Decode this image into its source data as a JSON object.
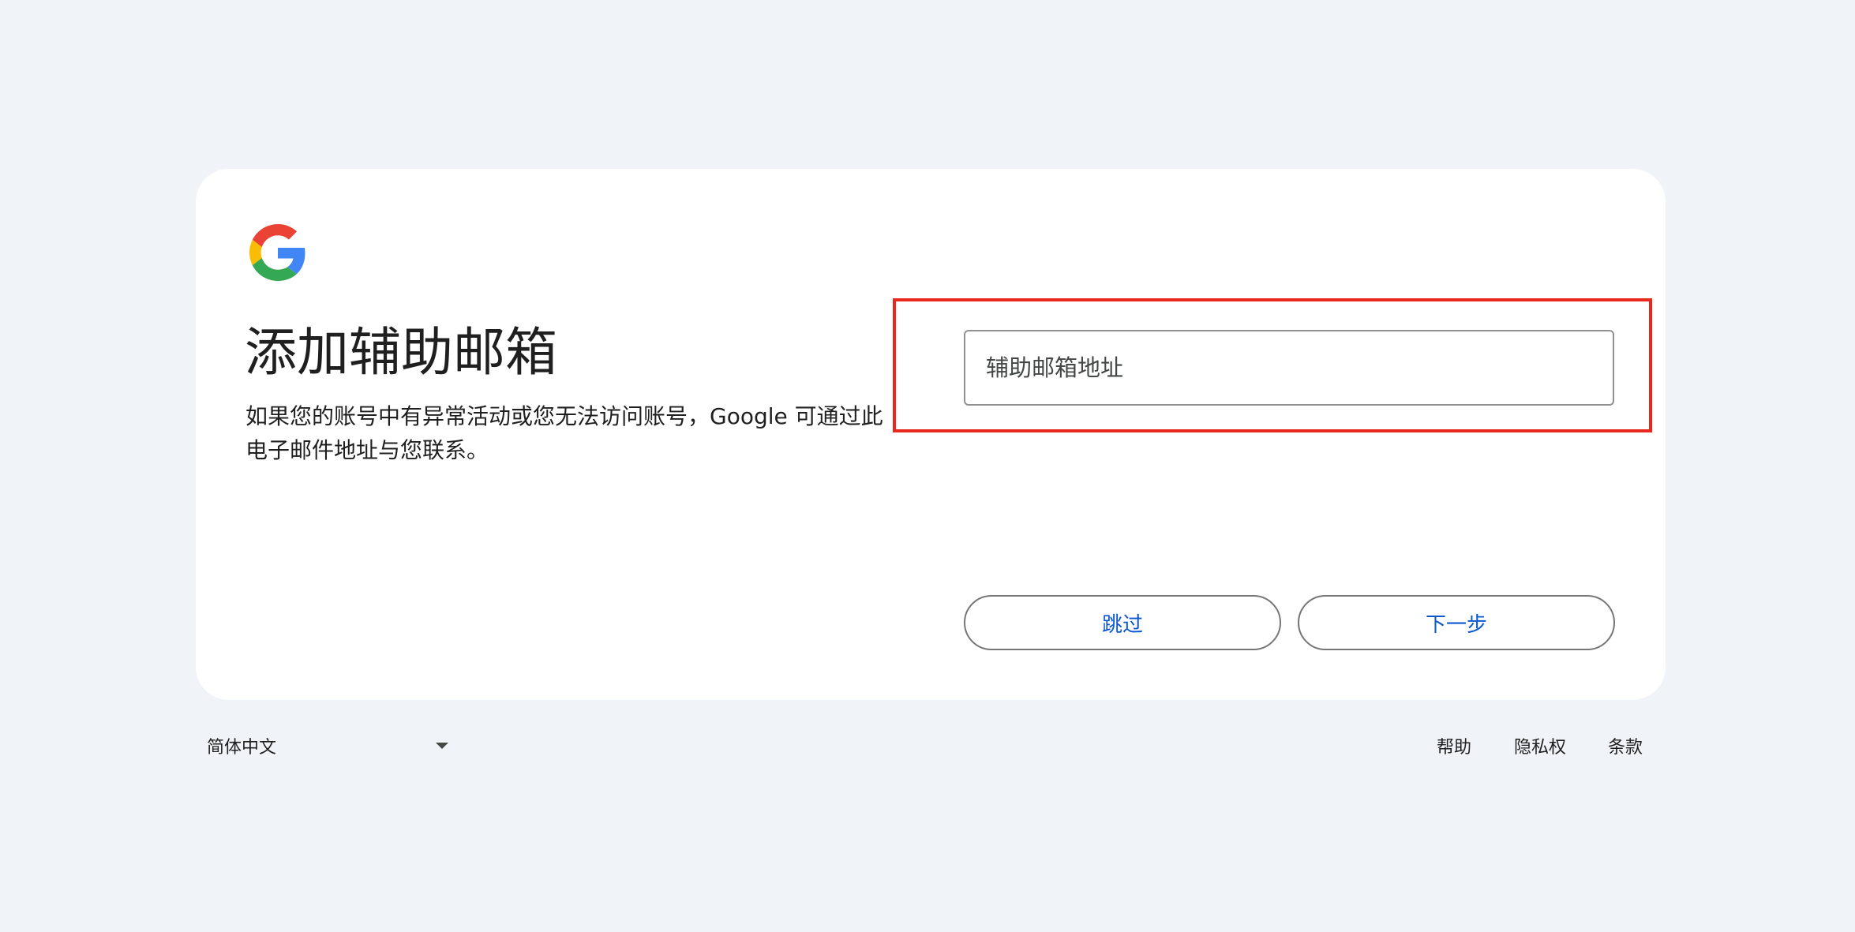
{
  "brand": {
    "logo_icon": "google-g-icon",
    "colors": {
      "blue": "#4285F4",
      "red": "#EA4335",
      "yellow": "#FBBC05",
      "green": "#34A853"
    }
  },
  "card": {
    "title": "添加辅助邮箱",
    "description": "如果您的账号中有异常活动或您无法访问账号，Google 可通过此电子邮件地址与您联系。"
  },
  "email_input": {
    "value": "",
    "placeholder": "辅助邮箱地址"
  },
  "buttons": {
    "skip_label": "跳过",
    "next_label": "下一步"
  },
  "footer": {
    "language": {
      "selected": "简体中文",
      "icon": "caret-down-icon"
    },
    "links": {
      "help": "帮助",
      "privacy": "隐私权",
      "terms": "条款"
    }
  },
  "colors": {
    "page_background": "#f0f4f9",
    "card_background": "#ffffff",
    "accent": "#0b57d0",
    "highlight_border": "#e8271d"
  }
}
